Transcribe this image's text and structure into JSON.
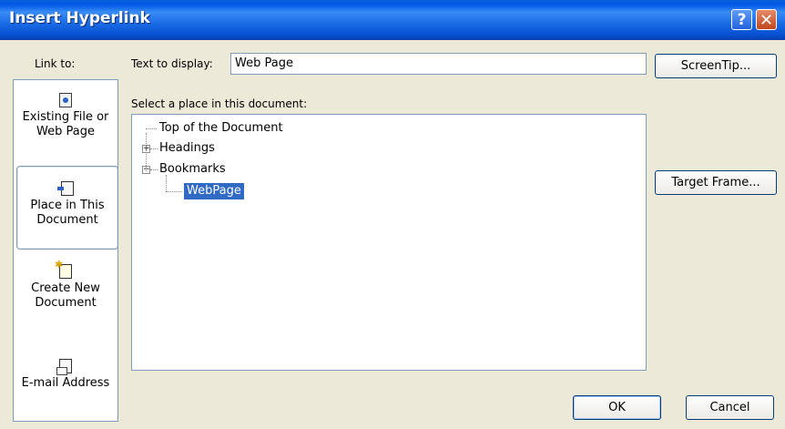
{
  "window": {
    "title": "Insert Hyperlink",
    "help_glyph": "?",
    "close_glyph": "✕"
  },
  "link_to": {
    "label": "Link to:",
    "items": [
      {
        "label": "Existing File or Web Page",
        "icon": "existing-file-icon"
      },
      {
        "label": "Place in This Document",
        "icon": "place-in-document-icon",
        "selected": true
      },
      {
        "label": "Create New Document",
        "icon": "new-document-icon"
      },
      {
        "label": "E-mail Address",
        "icon": "email-icon"
      }
    ]
  },
  "text_to_display": {
    "label": "Text to display:",
    "value": "Web Page"
  },
  "place_select": {
    "label": "Select a place in this document:",
    "tree": {
      "top": "Top of the Document",
      "headings": "Headings",
      "bookmarks": "Bookmarks",
      "webpage": "WebPage",
      "expand_plus": "+",
      "expand_minus": "−"
    }
  },
  "buttons": {
    "screentip": "ScreenTip...",
    "target_frame": "Target Frame...",
    "ok": "OK",
    "cancel": "Cancel"
  },
  "colors": {
    "titlebar": "#0058e6",
    "dialog_bg": "#ece9d8",
    "selection": "#316ac5",
    "border": "#7f9db9"
  }
}
